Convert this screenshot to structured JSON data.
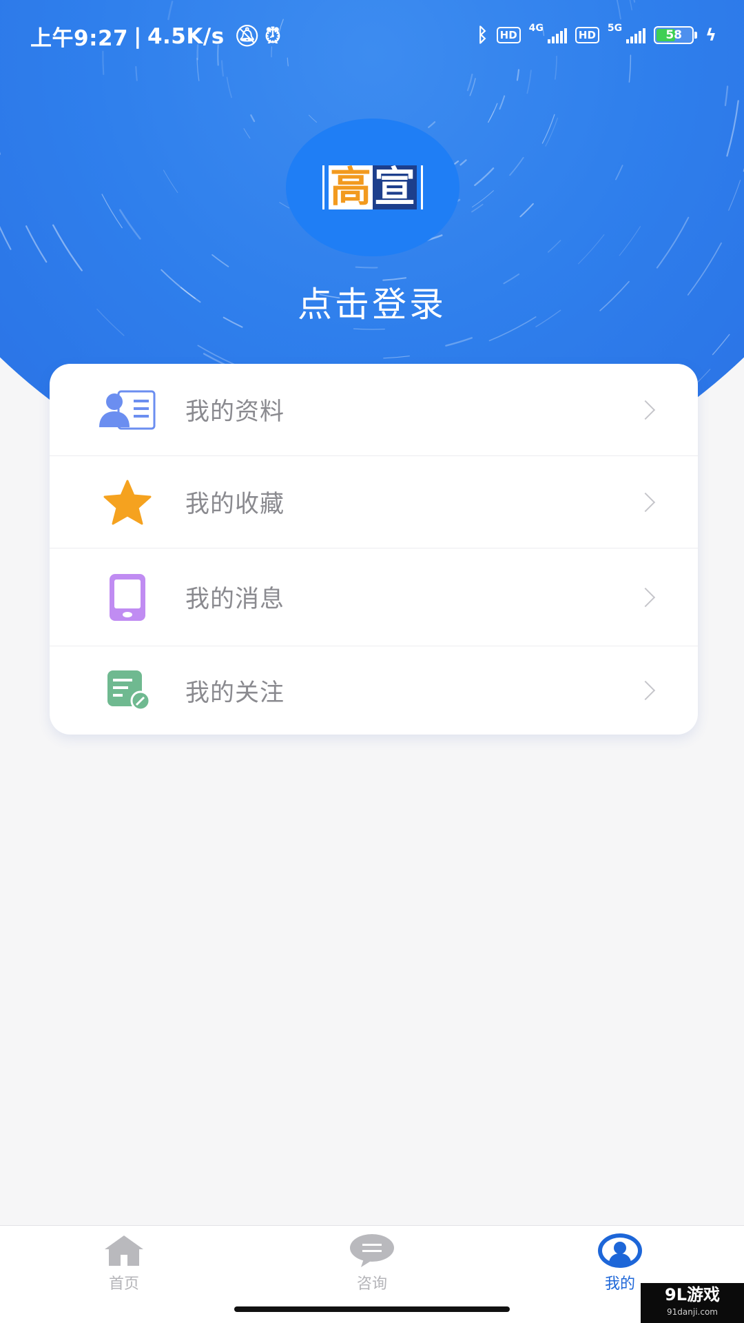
{
  "status_bar": {
    "time": "上午9:27",
    "net_speed": "4.5K/s",
    "network_1": "4G",
    "network_2": "5G",
    "hd": "HD",
    "battery": "58",
    "battery_level": 0.58
  },
  "header": {
    "logo_chars": [
      "高",
      "宣"
    ],
    "login_text": "点击登录"
  },
  "menu": {
    "items": [
      {
        "label": "我的资料",
        "icon": "profile-card-icon",
        "color": "#6b8ef0"
      },
      {
        "label": "我的收藏",
        "icon": "star-icon",
        "color": "#f5a21f"
      },
      {
        "label": "我的消息",
        "icon": "phone-icon",
        "color": "#c08cf2"
      },
      {
        "label": "我的关注",
        "icon": "note-edit-icon",
        "color": "#6fb990"
      }
    ]
  },
  "tabbar": {
    "tabs": [
      {
        "label": "首页",
        "icon": "home-icon"
      },
      {
        "label": "咨询",
        "icon": "chat-icon"
      },
      {
        "label": "我的",
        "icon": "user-icon"
      }
    ],
    "active": "我的",
    "active_color": "#1d66d8",
    "inactive_color": "#b4b4b8"
  },
  "watermark": {
    "main": "9L游戏",
    "sub": "91danji.com"
  },
  "colors": {
    "brand_blue": "#2a72e5",
    "page_bg": "#f6f6f7"
  }
}
